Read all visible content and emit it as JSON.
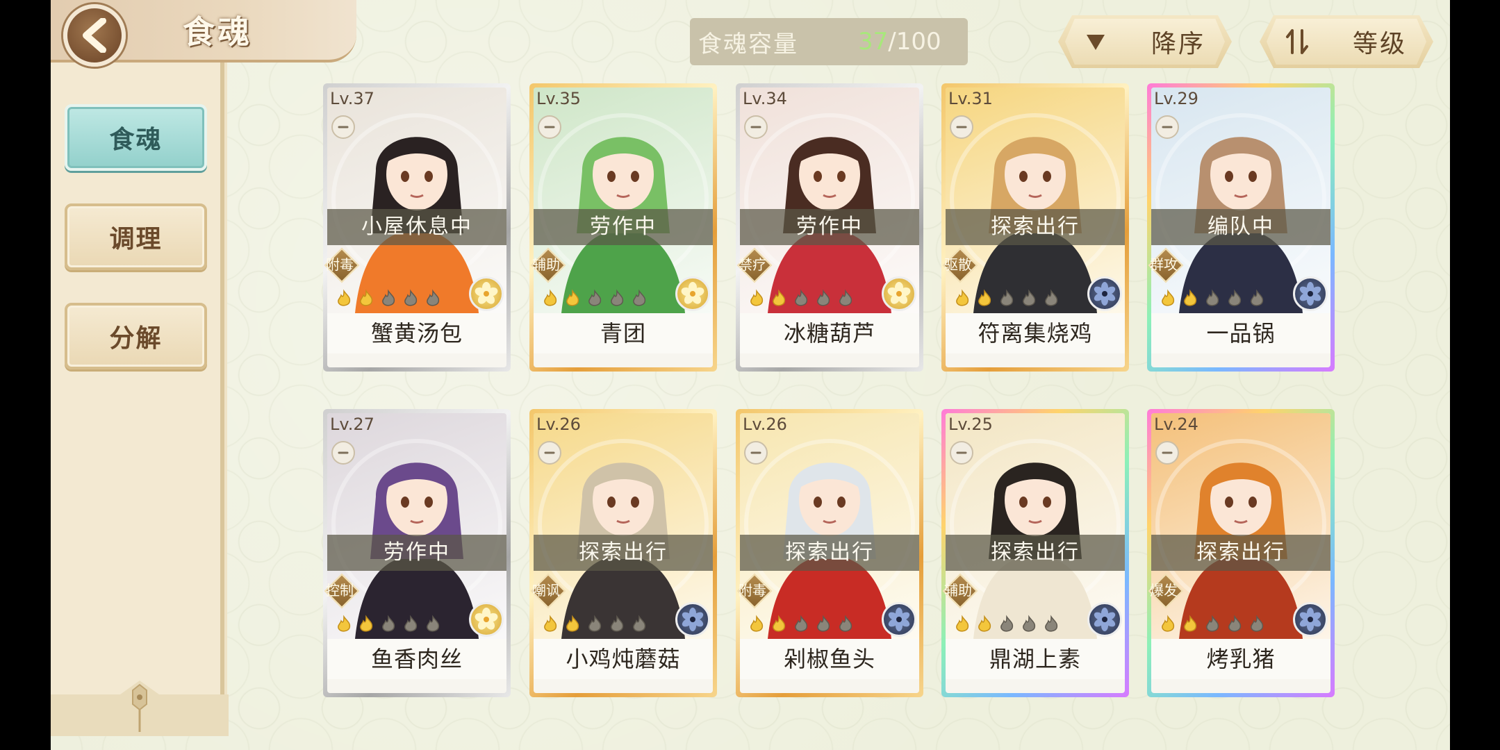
{
  "header": {
    "title": "食魂",
    "capacity_label": "食魂容量",
    "capacity_current": "37",
    "capacity_max": "/100"
  },
  "sort": {
    "order_label": "降序",
    "key_label": "等级"
  },
  "nav": {
    "items": [
      {
        "label": "食魂",
        "active": true
      },
      {
        "label": "调理",
        "active": false
      },
      {
        "label": "分解",
        "active": false
      }
    ]
  },
  "colors": {
    "capacity_current": "#a8e87b",
    "active_tab": "#92d0cb",
    "rarity_silver": "#cfcfcf",
    "rarity_gold": "#f3c66a",
    "rarity_rainbow": "#ff7ad9"
  },
  "cards": [
    {
      "level": "Lv.37",
      "status": "小屋休息中",
      "role": "附毒",
      "name": "蟹黄汤包",
      "rarity": "silver",
      "element": "gold",
      "flames_lit": 2,
      "art_bg": "#e9e3da",
      "hair": "#2a2222",
      "outfit": "#f07a2a"
    },
    {
      "level": "Lv.35",
      "status": "劳作中",
      "role": "辅助",
      "name": "青团",
      "rarity": "gold",
      "element": "gold",
      "flames_lit": 2,
      "art_bg": "#cfe6c8",
      "hair": "#79c065",
      "outfit": "#4ea34a"
    },
    {
      "level": "Lv.34",
      "status": "劳作中",
      "role": "禁疗",
      "name": "冰糖葫芦",
      "rarity": "silver",
      "element": "gold",
      "flames_lit": 2,
      "art_bg": "#f0e1da",
      "hair": "#4a2c22",
      "outfit": "#c9303a"
    },
    {
      "level": "Lv.31",
      "status": "探索出行",
      "role": "驱散",
      "name": "符离集烧鸡",
      "rarity": "gold",
      "element": "blue",
      "flames_lit": 2,
      "art_bg": "#f6d680",
      "hair": "#d7a764",
      "outfit": "#2f2f33"
    },
    {
      "level": "Lv.29",
      "status": "编队中",
      "role": "群攻",
      "name": "一品锅",
      "rarity": "rainbow",
      "element": "blue",
      "flames_lit": 2,
      "art_bg": "#d8e6f0",
      "hair": "#b8906f",
      "outfit": "#2c2f45"
    },
    {
      "level": "Lv.27",
      "status": "劳作中",
      "role": "控制",
      "name": "鱼香肉丝",
      "rarity": "silver",
      "element": "gold",
      "flames_lit": 2,
      "art_bg": "#ddd7dc",
      "hair": "#6b4a8c",
      "outfit": "#2b2430"
    },
    {
      "level": "Lv.26",
      "status": "探索出行",
      "role": "嘲讽",
      "name": "小鸡炖蘑菇",
      "rarity": "gold",
      "element": "blue",
      "flames_lit": 2,
      "art_bg": "#f6d98a",
      "hair": "#cfc2a8",
      "outfit": "#3a3434"
    },
    {
      "level": "Lv.26",
      "status": "探索出行",
      "role": "附毒",
      "name": "剁椒鱼头",
      "rarity": "gold",
      "element": "blue",
      "flames_lit": 2,
      "art_bg": "#f7e6b0",
      "hair": "#dfe5ea",
      "outfit": "#c82c25"
    },
    {
      "level": "Lv.25",
      "status": "探索出行",
      "role": "辅助",
      "name": "鼎湖上素",
      "rarity": "rainbow",
      "element": "blue",
      "flames_lit": 2,
      "art_bg": "#f3e6c4",
      "hair": "#2a2420",
      "outfit": "#efe6d2"
    },
    {
      "level": "Lv.24",
      "status": "探索出行",
      "role": "爆发",
      "name": "烤乳猪",
      "rarity": "rainbow",
      "element": "blue",
      "flames_lit": 2,
      "art_bg": "#f4c07a",
      "hair": "#e0822c",
      "outfit": "#b53a1e"
    }
  ]
}
